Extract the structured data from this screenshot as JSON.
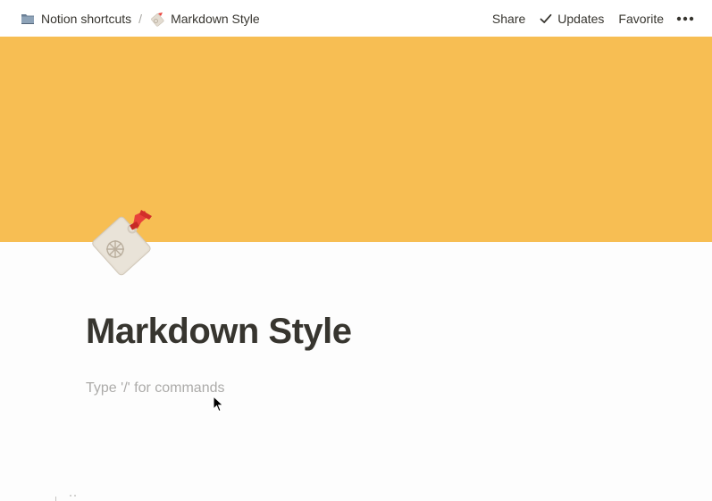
{
  "breadcrumb": {
    "workspace_label": "Notion shortcuts",
    "separator": "/",
    "page_label": "Markdown Style"
  },
  "actions": {
    "share": "Share",
    "updates": "Updates",
    "favorite": "Favorite"
  },
  "page": {
    "title": "Markdown Style",
    "placeholder": "Type '/' for commands"
  },
  "colors": {
    "cover": "#f7be53",
    "title": "#37352f",
    "placeholder": "#acaba9"
  },
  "icons": {
    "workspace": "folder-icon",
    "page": "name-badge-tag-icon",
    "updates": "checkmark-icon",
    "more": "more-options-icon"
  }
}
